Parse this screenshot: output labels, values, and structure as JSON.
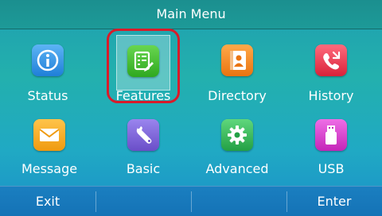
{
  "header": {
    "title": "Main Menu"
  },
  "menu": {
    "items": [
      {
        "label": "Status",
        "icon": "info-icon",
        "color": "#2f8fe0"
      },
      {
        "label": "Features",
        "icon": "features-icon",
        "color": "#3bbf2a",
        "selected": true
      },
      {
        "label": "Directory",
        "icon": "contact-book-icon",
        "color": "#f0861a"
      },
      {
        "label": "History",
        "icon": "call-history-icon",
        "color": "#e8344a"
      },
      {
        "label": "Message",
        "icon": "envelope-icon",
        "color": "#f3a51a"
      },
      {
        "label": "Basic",
        "icon": "wrench-icon",
        "color": "#7a5fd6"
      },
      {
        "label": "Advanced",
        "icon": "gear-icon",
        "color": "#2fb85a"
      },
      {
        "label": "USB",
        "icon": "usb-drive-icon",
        "color": "#d43ac8"
      }
    ]
  },
  "softkeys": {
    "left": "Exit",
    "right": "Enter"
  },
  "colors": {
    "selection_ring": "#d81b2a",
    "softkey_bar": "#1572b6"
  }
}
